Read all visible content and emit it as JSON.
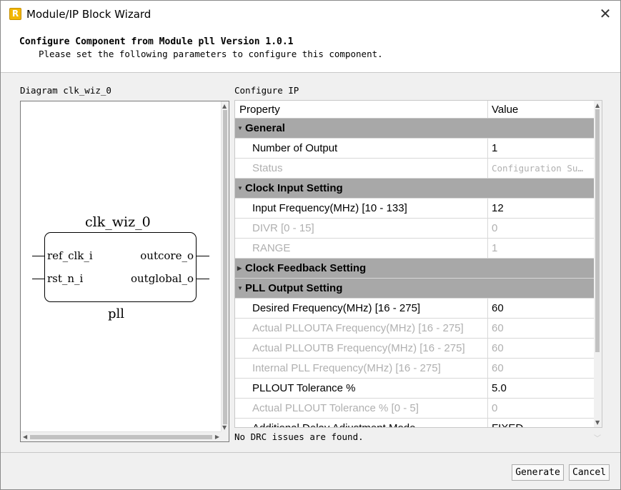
{
  "window": {
    "title": "Module/IP Block Wizard",
    "icon": "app-logo-icon",
    "icon_letter": "R",
    "close_glyph": "✕"
  },
  "header": {
    "title": "Configure Component from Module pll Version 1.0.1",
    "subtitle": "Please set the following parameters to configure this component."
  },
  "diagram": {
    "label": "Diagram clk_wiz_0",
    "instance_name": "clk_wiz_0",
    "module_type": "pll",
    "inputs": [
      "ref_clk_i",
      "rst_n_i"
    ],
    "outputs": [
      "outcore_o",
      "outglobal_o"
    ]
  },
  "config": {
    "label": "Configure IP",
    "headers": {
      "property": "Property",
      "value": "Value"
    },
    "rows": [
      {
        "kind": "group",
        "label": "General",
        "expanded": true
      },
      {
        "kind": "prop",
        "property": "Number of Output",
        "value": "1",
        "enabled": true
      },
      {
        "kind": "prop",
        "property": "Status",
        "value": "Configuration Su…",
        "enabled": false,
        "mono": true
      },
      {
        "kind": "group",
        "label": "Clock Input Setting",
        "expanded": true
      },
      {
        "kind": "prop",
        "property": "Input Frequency(MHz)  [10 - 133]",
        "value": "12",
        "enabled": true
      },
      {
        "kind": "prop",
        "property": "DIVR  [0 - 15]",
        "value": "0",
        "enabled": false
      },
      {
        "kind": "prop",
        "property": "RANGE",
        "value": "1",
        "enabled": false
      },
      {
        "kind": "group",
        "label": "Clock Feedback Setting",
        "expanded": false
      },
      {
        "kind": "group",
        "label": "PLL Output Setting",
        "expanded": true
      },
      {
        "kind": "prop",
        "property": "Desired Frequency(MHz)  [16 - 275]",
        "value": "60",
        "enabled": true
      },
      {
        "kind": "prop",
        "property": "Actual PLLOUTA Frequency(MHz)  [16 - 275]",
        "value": "60",
        "enabled": false
      },
      {
        "kind": "prop",
        "property": "Actual PLLOUTB Frequency(MHz)  [16 - 275]",
        "value": "60",
        "enabled": false
      },
      {
        "kind": "prop",
        "property": "Internal PLL Frequency(MHz)  [16 - 275]",
        "value": "60",
        "enabled": false
      },
      {
        "kind": "prop",
        "property": "PLLOUT Tolerance %",
        "value": "5.0",
        "enabled": true
      },
      {
        "kind": "prop",
        "property": "Actual PLLOUT Tolerance %  [0 - 5]",
        "value": "0",
        "enabled": false
      },
      {
        "kind": "prop",
        "property": "Additional Delay Adjustment Mode",
        "value": "FIXED",
        "enabled": true
      }
    ]
  },
  "drc_message": "No DRC issues are found.",
  "buttons": {
    "generate": "Generate",
    "cancel": "Cancel"
  },
  "colors": {
    "group_bg": "#a8a8a8",
    "disabled_text": "#b0b0b0",
    "dialog_bg": "#f0f0f0",
    "icon_accent": "#f2b705"
  }
}
